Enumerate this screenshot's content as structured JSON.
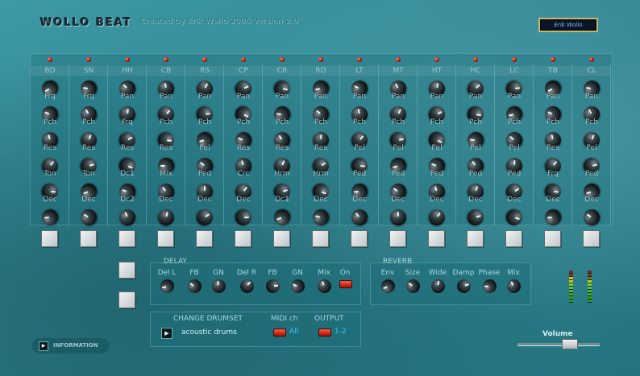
{
  "header": {
    "title": "WOLLO BEAT",
    "credit": "Created by Erik Wøllo 2006 Version 2.0",
    "badge": "Erik Wollo"
  },
  "channels": [
    {
      "name": "BD",
      "params": [
        "Frq",
        "Pch",
        "Res",
        "Ton",
        "Dec"
      ]
    },
    {
      "name": "SN",
      "params": [
        "Frq",
        "Pch",
        "Res",
        "Ton",
        "Dec"
      ]
    },
    {
      "name": "HH",
      "params": [
        "Pan",
        "Frq",
        "Res",
        "Dc1",
        "Dc2"
      ]
    },
    {
      "name": "CB",
      "params": [
        "Pan",
        "Pch",
        "Res",
        "Mix",
        "Dec"
      ]
    },
    {
      "name": "RS",
      "params": [
        "Pan",
        "Pch",
        "Pel",
        "Ped",
        "Dec"
      ]
    },
    {
      "name": "CP",
      "params": [
        "Pan",
        "Pch",
        "Res",
        "Crc",
        "Dec"
      ]
    },
    {
      "name": "CR",
      "params": [
        "Pan",
        "Pch",
        "Res",
        "Hrm",
        "Dc1"
      ]
    },
    {
      "name": "RD",
      "params": [
        "Pan",
        "Pch",
        "Res",
        "Hrm",
        "Dec"
      ]
    },
    {
      "name": "LT",
      "params": [
        "Pan",
        "Pch",
        "Pel",
        "Ped",
        "Dec"
      ]
    },
    {
      "name": "MT",
      "params": [
        "Pan",
        "Pch",
        "Pel",
        "Ped",
        "Dec"
      ]
    },
    {
      "name": "HT",
      "params": [
        "Pan",
        "Pch",
        "Pel",
        "Ped",
        "Dec"
      ]
    },
    {
      "name": "HC",
      "params": [
        "Pan",
        "Pch",
        "Pel",
        "Ped",
        "Dec"
      ]
    },
    {
      "name": "LC",
      "params": [
        "Pan",
        "Pch",
        "Pel",
        "Ped",
        "Dec"
      ]
    },
    {
      "name": "TB",
      "params": [
        "Pan",
        "Pch",
        "Res",
        "Frq",
        "Dec"
      ]
    },
    {
      "name": "CL",
      "params": [
        "Pan",
        "Pch",
        "Pel",
        "Ped",
        "Dec"
      ]
    }
  ],
  "delay": {
    "title": "DELAY",
    "labels": [
      "Del L",
      "FB",
      "GN",
      "Del R",
      "FB",
      "GN",
      "Mix",
      "On"
    ]
  },
  "reverb": {
    "title": "REVERB",
    "labels": [
      "Env",
      "Size",
      "Wide",
      "Damp",
      "Phase",
      "Mix"
    ]
  },
  "drumset": {
    "title": "CHANGE DRUMSET",
    "value": "acoustic drums",
    "midi_label": "MIDI ch",
    "midi_value": "All",
    "output_label": "OUTPUT",
    "output_value": "1-2"
  },
  "info": {
    "label": "INFORMATION"
  },
  "volume": {
    "label": "Volume",
    "level": 0.65
  },
  "colors": {
    "accent": "#2e838f",
    "led": "#d4150a"
  }
}
